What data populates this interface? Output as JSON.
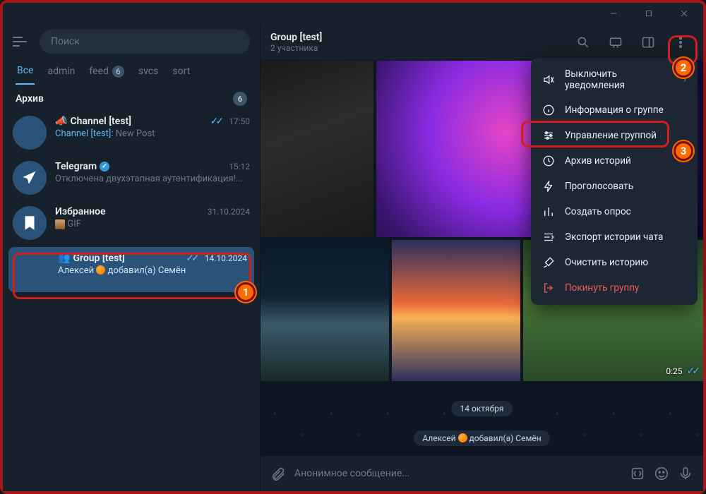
{
  "window": {
    "min": "minimize",
    "max": "maximize",
    "close": "close"
  },
  "search": {
    "placeholder": "Поиск"
  },
  "folders": [
    {
      "label": "Все",
      "active": true
    },
    {
      "label": "admin"
    },
    {
      "label": "feed",
      "badge": "6"
    },
    {
      "label": "svcs"
    },
    {
      "label": "sort"
    }
  ],
  "archive": {
    "title": "Архив",
    "badge": "6"
  },
  "chats": [
    {
      "name": "Channel [test]",
      "icon": "megaphone",
      "time": "17:50",
      "checks": true,
      "preview_sender": "Channel [test]:",
      "preview_text": "New Post"
    },
    {
      "name": "Telegram",
      "verified": true,
      "time": "15:12",
      "preview_text": "Отключена двухэтапная аутентификация!..."
    },
    {
      "name": "Избранное",
      "time": "31.10.2024",
      "preview_text": "GIF",
      "gif": true
    },
    {
      "name": "Group [test]",
      "icon": "group",
      "time": "14.10.2024",
      "checks": true,
      "selected": true,
      "preview_sender": "Алексей",
      "preview_text": "добавил(а) Семён"
    }
  ],
  "header": {
    "title": "Group [test]",
    "subtitle": "2 участника"
  },
  "menu": [
    {
      "icon": "mute",
      "label": "Выключить уведомления",
      "chevron": true
    },
    {
      "icon": "info",
      "label": "Информация о группе"
    },
    {
      "icon": "manage",
      "label": "Управление группой",
      "highlight": true
    },
    {
      "icon": "archive",
      "label": "Архив историй"
    },
    {
      "icon": "boost",
      "label": "Проголосовать"
    },
    {
      "icon": "poll",
      "label": "Создать опрос"
    },
    {
      "icon": "export",
      "label": "Экспорт истории чата"
    },
    {
      "icon": "clear",
      "label": "Очистить историю"
    },
    {
      "icon": "leave",
      "label": "Покинуть группу",
      "danger": true
    }
  ],
  "video": {
    "duration": "0:25"
  },
  "chips": {
    "date": "14 октября",
    "system_prefix": "Алексей ",
    "system_suffix": " добавил(а) Семён"
  },
  "compose": {
    "placeholder": "Анонимное сообщение..."
  },
  "markers": {
    "m1": "1",
    "m2": "2",
    "m3": "3"
  }
}
